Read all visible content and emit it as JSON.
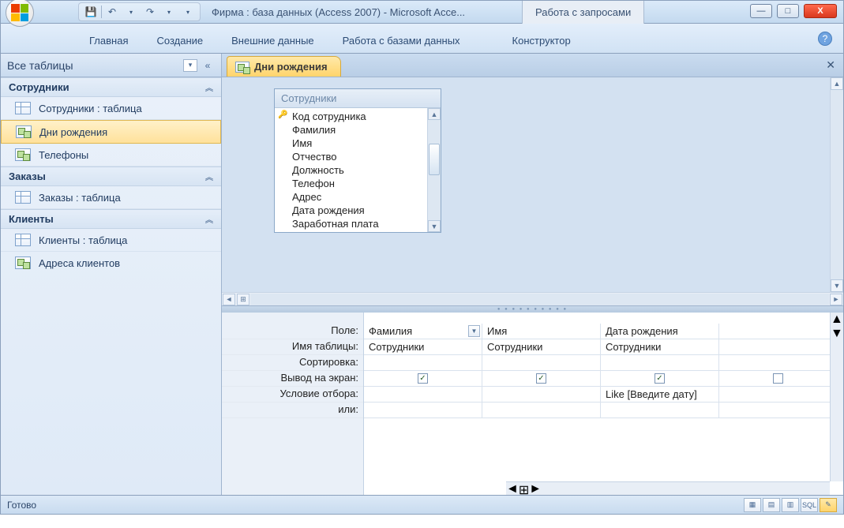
{
  "title": "Фирма : база данных (Access 2007)  -  Microsoft Acce...",
  "context_tab": "Работа с запросами",
  "ribbon_tabs": [
    "Главная",
    "Создание",
    "Внешние данные",
    "Работа с базами данных",
    "Конструктор"
  ],
  "nav": {
    "header": "Все таблицы",
    "groups": [
      {
        "title": "Сотрудники",
        "items": [
          {
            "type": "table",
            "label": "Сотрудники : таблица"
          },
          {
            "type": "query",
            "label": "Дни рождения",
            "selected": true
          },
          {
            "type": "query",
            "label": "Телефоны"
          }
        ]
      },
      {
        "title": "Заказы",
        "items": [
          {
            "type": "table",
            "label": "Заказы : таблица"
          }
        ]
      },
      {
        "title": "Клиенты",
        "items": [
          {
            "type": "table",
            "label": "Клиенты : таблица"
          },
          {
            "type": "query",
            "label": "Адреса клиентов"
          }
        ]
      }
    ]
  },
  "doc": {
    "tab_label": "Дни рождения",
    "fieldlist": {
      "title": "Сотрудники",
      "fields": [
        "Код сотрудника",
        "Фамилия",
        "Имя",
        "Отчество",
        "Должность",
        "Телефон",
        "Адрес",
        "Дата рождения",
        "Заработная плата"
      ],
      "key_index": 0
    }
  },
  "qbe": {
    "labels": [
      "Поле:",
      "Имя таблицы:",
      "Сортировка:",
      "Вывод на экран:",
      "Условие отбора:",
      "или:"
    ],
    "columns": [
      {
        "field": "Фамилия",
        "table": "Сотрудники",
        "sort": "",
        "show": true,
        "criteria": "",
        "or": ""
      },
      {
        "field": "Имя",
        "table": "Сотрудники",
        "sort": "",
        "show": true,
        "criteria": "",
        "or": ""
      },
      {
        "field": "Дата рождения",
        "table": "Сотрудники",
        "sort": "",
        "show": true,
        "criteria": "Like [Введите дату]",
        "or": ""
      }
    ]
  },
  "status": "Готово",
  "sql_label": "SQL"
}
